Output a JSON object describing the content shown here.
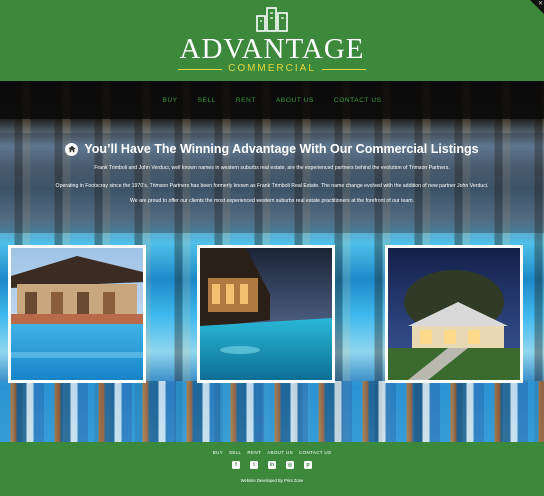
{
  "brand": {
    "name": "ADVANTAGE",
    "tagline": "COMMERCIAL"
  },
  "nav": {
    "items": [
      "BUY",
      "SELL",
      "RENT",
      "ABOUT US",
      "CONTACT US"
    ]
  },
  "intro": {
    "title": "You’ll Have The Winning Advantage With Our Commercial Listings",
    "paragraphs": [
      "Frank Trimboli and John Verduci, well known names in western suburbs real estate, are the experienced partners behind the evolution of Trimson Partners.",
      "Operating in Footscray since the 1970’s, Trimson Partners has been formerly known as Frank Trimboli Real Estate. The name change evolved with the addition of new partner John Verduci.",
      "We are proud to offer our clients the most experienced western suburbs real estate practitioners at the forefront of our team."
    ]
  },
  "footer": {
    "nav": [
      "BUY",
      "SELL",
      "RENT",
      "ABOUT US",
      "CONTACT US"
    ],
    "socials": [
      {
        "icon": "facebook-icon",
        "glyph": "f"
      },
      {
        "icon": "twitter-icon",
        "glyph": "t"
      },
      {
        "icon": "linkedin-icon",
        "glyph": "in"
      },
      {
        "icon": "instagram-icon",
        "glyph": "◎"
      },
      {
        "icon": "pinterest-icon",
        "glyph": "p"
      }
    ],
    "credit": "Website Developed By Print Zone"
  },
  "colors": {
    "brand_green": "#3d893c",
    "nav_green": "#3e9e3c",
    "tagline_yellow": "#e3d73f"
  }
}
